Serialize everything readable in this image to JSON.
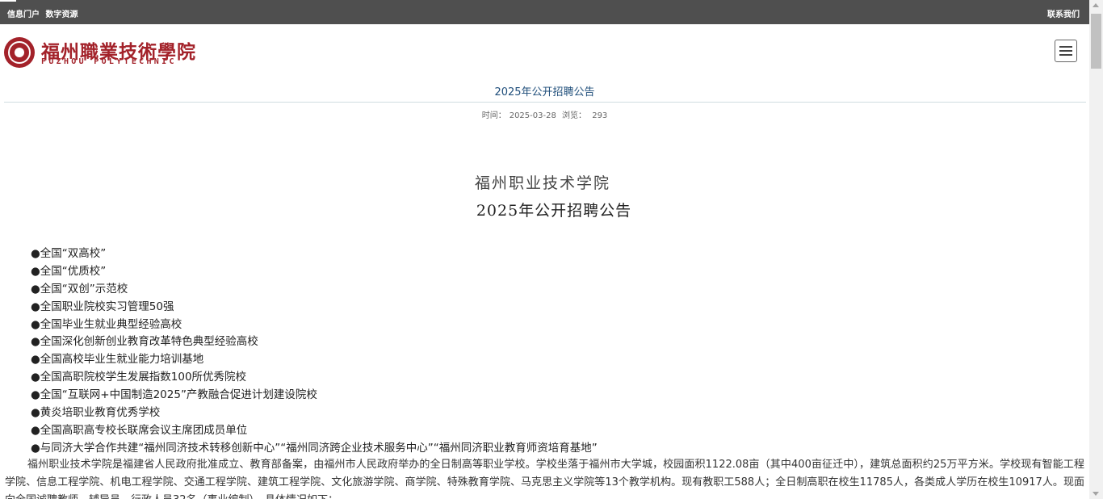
{
  "topbar": {
    "links": [
      "信息门户",
      "数字资源"
    ],
    "contact": "联系我们"
  },
  "logo": {
    "name_cn": "福州職業技術學院",
    "name_en": "FUZHOU POLYTECHNIC"
  },
  "article": {
    "title": "2025年公开招聘公告",
    "meta": {
      "date_label": "时间：",
      "date": "2025-03-28",
      "views_label": "浏览：",
      "views": "293"
    },
    "org": "福州职业技术学院",
    "heading": "2025年公开招聘公告",
    "honors": [
      "●全国“双高校”",
      "●全国“优质校”",
      "●全国“双创”示范校",
      "●全国职业院校实习管理50强",
      "●全国毕业生就业典型经验高校",
      "●全国深化创新创业教育改革特色典型经验高校",
      "●全国高校毕业生就业能力培训基地",
      "●全国高职院校学生发展指数100所优秀院校",
      "●全国“互联网+中国制造2025”产教融合促进计划建设院校",
      "●黄炎培职业教育优秀学校",
      "●全国高职高专校长联席会议主席团成员单位",
      "●与同济大学合作共建“福州同济技术转移创新中心”“福州同济跨企业技术服务中心”“福州同济职业教育师资培育基地”"
    ],
    "paragraph": "福州职业技术学院是福建省人民政府批准成立、教育部备案，由福州市人民政府举办的全日制高等职业学校。学校坐落于福州市大学城，校园面积1122.08亩（其中400亩征迁中），建筑总面积约25万平方米。学校现有智能工程学院、信息工程学院、机电工程学院、交通工程学院、建筑工程学院、文化旅游学院、商学院、特殊教育学院、马克思主义学院等13个教学机构。现有教职工588人；全日制高职在校生11785人，各类成人学历在校生10917人。现面向全国诚聘教师、辅导员、行政人员32名（事业编制），具体情况如下："
  }
}
